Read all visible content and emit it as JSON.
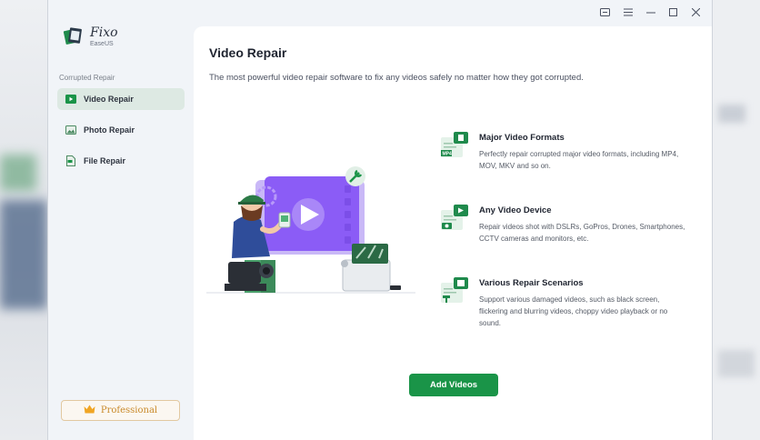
{
  "app": {
    "name": "Fixo",
    "vendor": "EaseUS"
  },
  "titlebar": {
    "icons": [
      "feedback-icon",
      "menu-icon",
      "minimize-icon",
      "maximize-icon",
      "close-icon"
    ]
  },
  "sidebar": {
    "section_label": "Corrupted Repair",
    "items": [
      {
        "label": "Video Repair",
        "icon": "video-icon",
        "active": true
      },
      {
        "label": "Photo Repair",
        "icon": "photo-icon",
        "active": false
      },
      {
        "label": "File Repair",
        "icon": "file-icon",
        "active": false
      }
    ],
    "professional_label": "Professional"
  },
  "main": {
    "title": "Video Repair",
    "subtitle": "The most powerful video repair software to fix any videos safely no matter how they got corrupted.",
    "features": [
      {
        "title": "Major Video Formats",
        "description": "Perfectly repair corrupted major video formats, including MP4, MOV, MKV and so on.",
        "icon": "video-formats-icon",
        "badge": "MP4"
      },
      {
        "title": "Any Video Device",
        "description": "Repair videos shot with DSLRs, GoPros, Drones, Smartphones, CCTV cameras and monitors, etc.",
        "icon": "video-device-icon"
      },
      {
        "title": "Various Repair Scenarios",
        "description": "Support various damaged videos, such as black screen, flickering and blurring videos, choppy video playback or no sound.",
        "icon": "repair-scenarios-icon"
      }
    ],
    "add_button": "Add Videos"
  },
  "colors": {
    "accent": "#1a9448",
    "active_nav": "#dde9e3",
    "illustration_purple": "#8b5cf6",
    "professional": "#c98a2a"
  }
}
